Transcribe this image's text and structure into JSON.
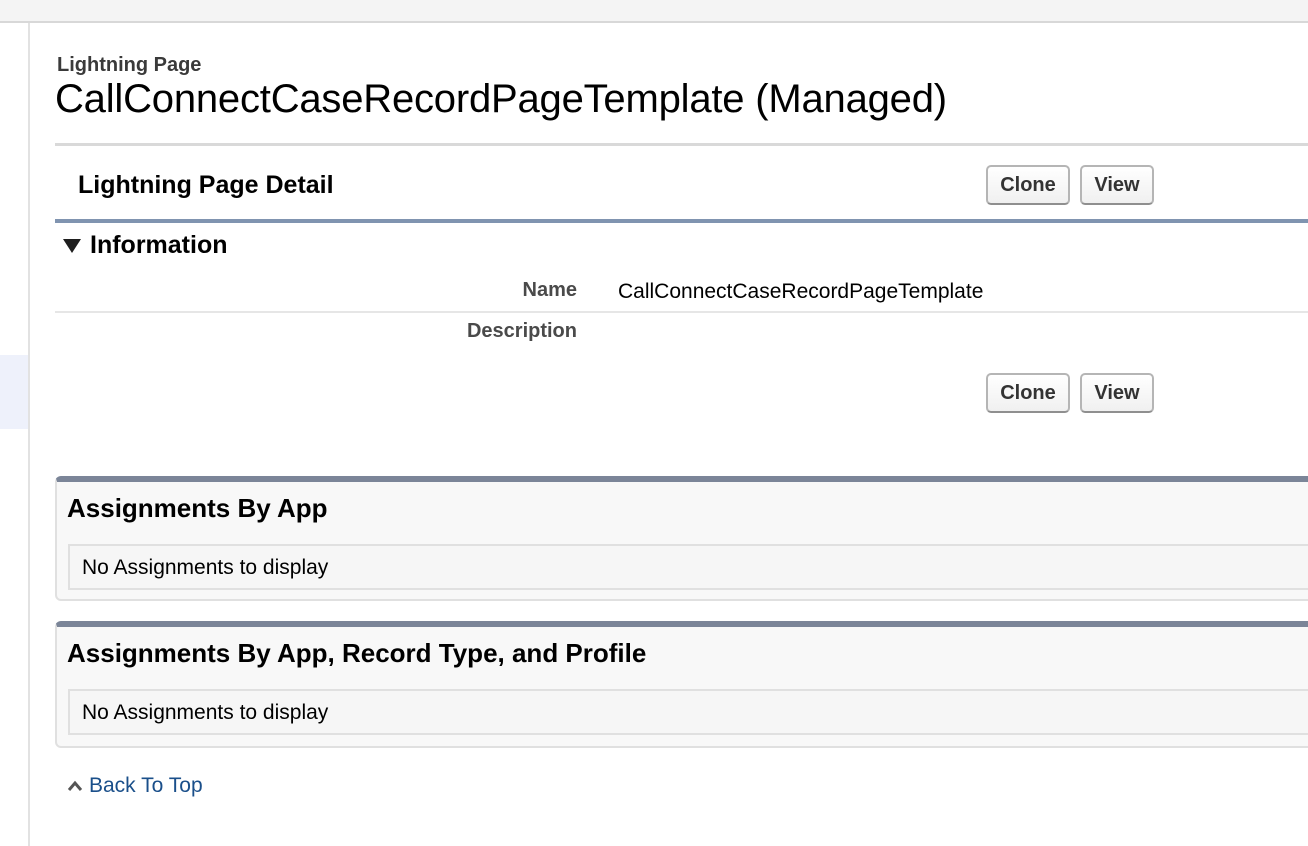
{
  "header": {
    "page_type": "Lightning Page",
    "title": "CallConnectCaseRecordPageTemplate (Managed)"
  },
  "detail": {
    "title": "Lightning Page Detail",
    "clone_label": "Clone",
    "view_label": "View"
  },
  "information": {
    "title": "Information",
    "fields": [
      {
        "label": "Name",
        "value": "CallConnectCaseRecordPageTemplate"
      },
      {
        "label": "Description",
        "value": ""
      }
    ]
  },
  "related_lists": [
    {
      "title": "Assignments By App",
      "empty_text": "No Assignments to display"
    },
    {
      "title": "Assignments By App, Record Type, and Profile",
      "empty_text": "No Assignments to display"
    }
  ],
  "footer": {
    "back_to_top": "Back To Top"
  },
  "icons": {
    "section_toggle": "triangle-down-icon",
    "back_to_top": "chevron-up-icon"
  },
  "colors": {
    "section_rule": "#8094b0",
    "related_border": "#7b8598",
    "link": "#1a4f8a"
  }
}
